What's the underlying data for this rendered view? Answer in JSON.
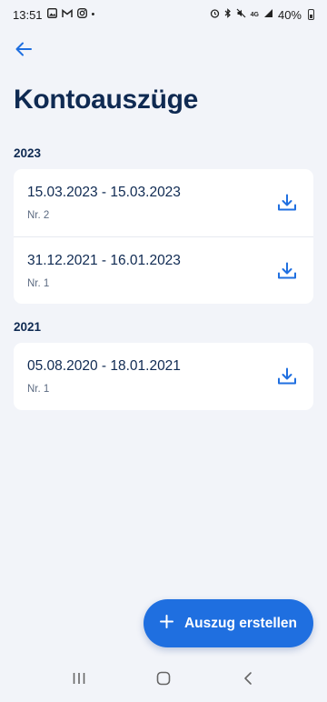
{
  "status_bar": {
    "time": "13:51",
    "dot": "•",
    "signal_label": "4G",
    "battery_percent": "40%",
    "left_icons": [
      "gallery-icon",
      "mail-icon",
      "instagram-icon"
    ],
    "right_icons": [
      "alarm-icon",
      "bluetooth-icon",
      "mute-icon",
      "signal-icon",
      "battery-icon"
    ]
  },
  "header": {
    "back_icon": "arrow-left-icon",
    "title": "Kontoauszüge"
  },
  "sections": [
    {
      "year": "2023",
      "statements": [
        {
          "range": "15.03.2023 - 15.03.2023",
          "number": "Nr. 2"
        },
        {
          "range": "31.12.2021 - 16.01.2023",
          "number": "Nr. 1"
        }
      ]
    },
    {
      "year": "2021",
      "statements": [
        {
          "range": "05.08.2020 - 18.01.2021",
          "number": "Nr. 1"
        }
      ]
    }
  ],
  "fab": {
    "icon": "plus-icon",
    "label": "Auszug erstellen"
  },
  "nav_bar": {
    "icons": [
      "recent-apps-icon",
      "home-icon",
      "back-nav-icon"
    ]
  },
  "colors": {
    "background": "#f2f4f9",
    "primary": "#1f6fe0",
    "text": "#0f2a52",
    "muted": "#5c6b82",
    "card": "#ffffff"
  }
}
